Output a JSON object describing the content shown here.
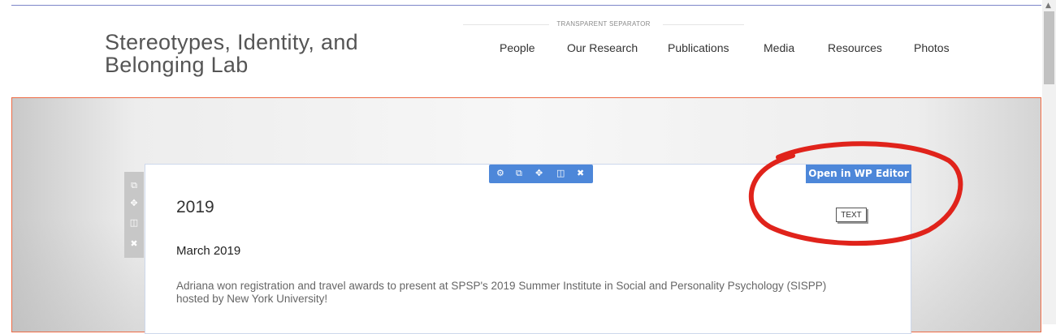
{
  "header": {
    "site_title_line1": "Stereotypes, Identity, and",
    "site_title_line2": "Belonging Lab",
    "separator_label": "TRANSPARENT SEPARATOR",
    "nav": [
      "People",
      "Our Research",
      "Publications",
      "Media",
      "Resources",
      "Photos"
    ]
  },
  "editor": {
    "wp_editor_button": "Open in WP Editor",
    "element_tag": "TEXT",
    "toolbar_icons": [
      "gear-icon",
      "duplicate-icon",
      "move-icon",
      "columns-icon",
      "close-icon"
    ],
    "side_toolbar_icons": [
      "duplicate-icon",
      "move-icon",
      "columns-icon",
      "close-icon"
    ],
    "accent_color": "#4d87d9",
    "annotation_color": "#e0231b"
  },
  "content": {
    "year_heading": "2019",
    "month_heading": "March 2019",
    "paragraph": "Adriana won registration and travel awards to present at SPSP's 2019 Summer Institute in Social and Personality Psychology (SISPP) hosted by New York University!"
  }
}
